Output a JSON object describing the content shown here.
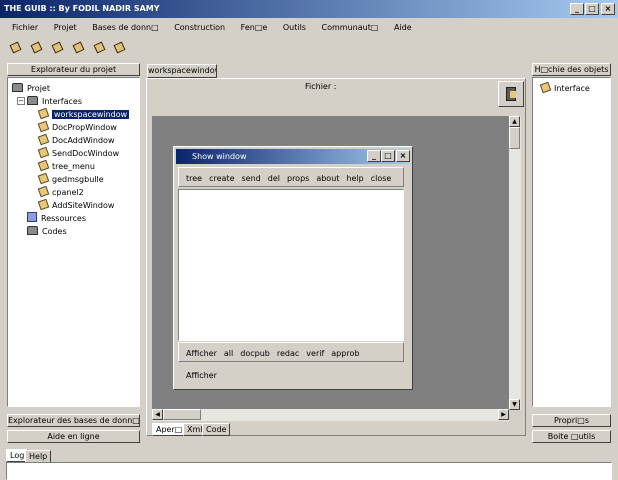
{
  "window": {
    "title": "THE GUIB :: By FODIL NADIR SAMY"
  },
  "menubar": [
    "Fichier",
    "Projet",
    "Bases de donn□",
    "Construction",
    "Fen□e",
    "Outils",
    "Communaut□",
    "Aide"
  ],
  "toolbar_icons": [
    "bug-icon-1",
    "bug-icon-2",
    "bug-icon-3",
    "bug-icon-4",
    "bug-icon-5",
    "bug-icon-6"
  ],
  "left_panel": {
    "header": "Explorateur du projet",
    "tree": {
      "root": "Projet",
      "interfaces": "Interfaces",
      "interfaces_toggle": "−",
      "children": [
        "workspacewindow",
        "DocPropWindow",
        "DocAddWindow",
        "SendDocWindow",
        "tree_menu",
        "gedmsgbulle",
        "cpanel2",
        "AddSiteWindow"
      ],
      "selected": "workspacewindow",
      "ressources": "Ressources",
      "codes": "Codes"
    },
    "btn_db_explorer": "Explorateur des bases de donn□",
    "btn_help": "Aide en ligne"
  },
  "center": {
    "tab": "workspacewindow",
    "label": "Fichier :",
    "bottom_tabs": [
      "Aper□",
      "Xml",
      "Code"
    ]
  },
  "inner_window": {
    "title": "Show window",
    "toolbar_top": [
      "tree",
      "create",
      "send",
      "del",
      "props",
      "about",
      "help",
      "close"
    ],
    "toolbar_bottom": [
      "Afficher",
      "all",
      "docpub",
      "redac",
      "verif",
      "approb"
    ],
    "status": "Afficher"
  },
  "right_panel": {
    "header": "H□chie des objets",
    "tree_item": "Interface",
    "btn_props": "Propri□s",
    "btn_toolbox": "Boite □utils"
  },
  "bottom": {
    "tabs": [
      "Log",
      "Help"
    ]
  },
  "colors": {
    "titlebar": "#0a246a",
    "selection": "#0a246a",
    "canvas": "#808080"
  }
}
